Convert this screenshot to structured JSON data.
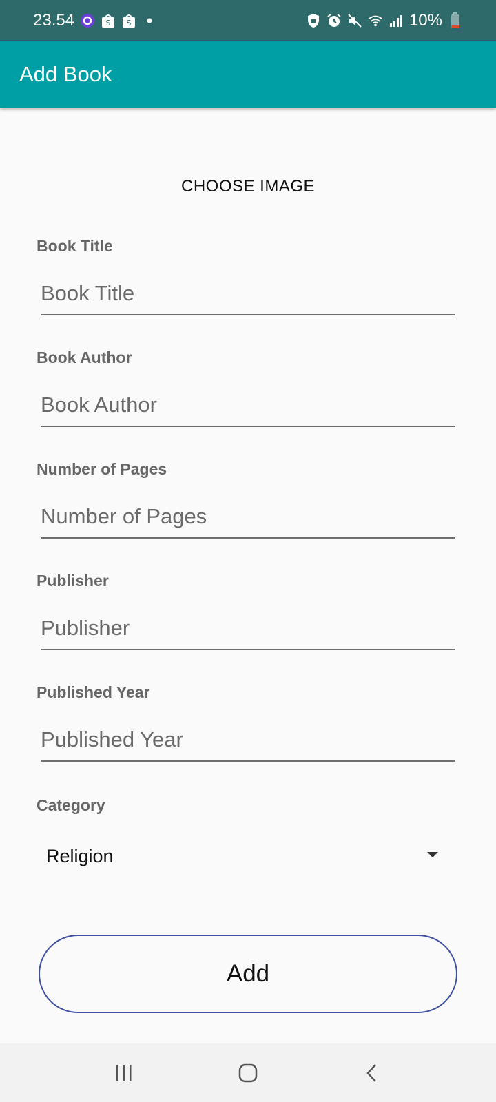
{
  "status_bar": {
    "time": "23.54",
    "battery": "10%",
    "left_icons": [
      "circle-app-icon",
      "shopee-bag-icon",
      "shopee-bag-icon",
      "dot-icon"
    ],
    "right_icons": [
      "shield-lock-icon",
      "alarm-icon",
      "mute-icon",
      "wifi-icon",
      "signal-icon",
      "battery-icon"
    ],
    "bg_color": "#2e6a6a"
  },
  "app_bar": {
    "title": "Add Book",
    "bg_color": "#009fa5"
  },
  "choose_image_label": "CHOOSE IMAGE",
  "fields": [
    {
      "label": "Book Title",
      "placeholder": "Book Title",
      "value": ""
    },
    {
      "label": "Book Author",
      "placeholder": "Book Author",
      "value": ""
    },
    {
      "label": "Number of Pages",
      "placeholder": "Number of Pages",
      "value": ""
    },
    {
      "label": "Publisher",
      "placeholder": "Publisher",
      "value": ""
    },
    {
      "label": "Published Year",
      "placeholder": "Published Year",
      "value": ""
    }
  ],
  "category": {
    "label": "Category",
    "selected": "Religion"
  },
  "add_button": {
    "label": "Add",
    "border_color": "#3f4f9f"
  },
  "nav_bar": {
    "items": [
      "recent-apps-icon",
      "home-icon",
      "back-icon"
    ]
  }
}
